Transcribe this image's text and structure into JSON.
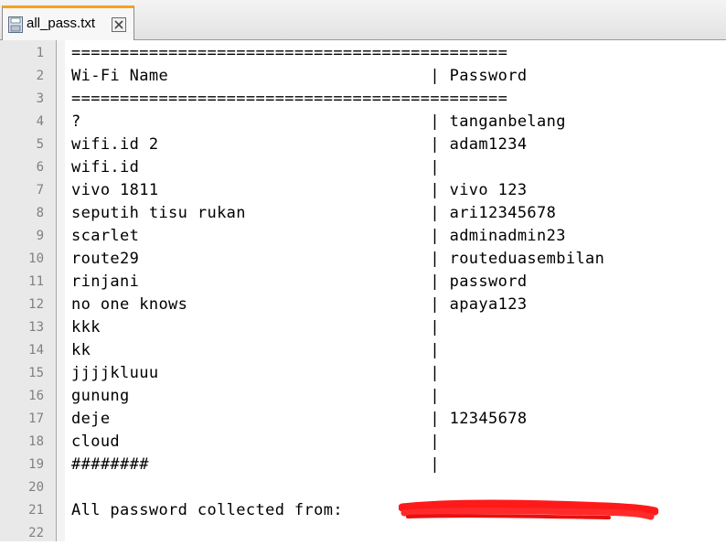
{
  "tab": {
    "title": "all_pass.txt",
    "doc_icon": "save-disk-icon",
    "close_icon": "close-icon",
    "accent_color": "#f6a21c"
  },
  "editor": {
    "lines": [
      {
        "num": "1",
        "text": "============================================="
      },
      {
        "num": "2",
        "text": "Wi-Fi Name                           | Password"
      },
      {
        "num": "3",
        "text": "============================================="
      },
      {
        "num": "4",
        "text": "?                                    | tanganbelang"
      },
      {
        "num": "5",
        "text": "wifi.id 2                            | adam1234"
      },
      {
        "num": "6",
        "text": "wifi.id                              |"
      },
      {
        "num": "7",
        "text": "vivo 1811                            | vivo 123"
      },
      {
        "num": "8",
        "text": "seputih tisu rukan                   | ari12345678"
      },
      {
        "num": "9",
        "text": "scarlet                              | adminadmin23"
      },
      {
        "num": "10",
        "text": "route29                              | routeduasembilan"
      },
      {
        "num": "11",
        "text": "rinjani                              | password"
      },
      {
        "num": "12",
        "text": "no one knows                         | apaya123"
      },
      {
        "num": "13",
        "text": "kkk                                  |"
      },
      {
        "num": "14",
        "text": "kk                                   |"
      },
      {
        "num": "15",
        "text": "jjjjkluuu                            |"
      },
      {
        "num": "16",
        "text": "gunung                               |"
      },
      {
        "num": "17",
        "text": "deje                                 | 12345678"
      },
      {
        "num": "18",
        "text": "cloud                                |"
      },
      {
        "num": "19",
        "text": "########                             |"
      },
      {
        "num": "20",
        "text": ""
      },
      {
        "num": "21",
        "text": "All password collected from: "
      },
      {
        "num": "22",
        "text": ""
      }
    ],
    "redaction_color": "#ff1a1a"
  }
}
